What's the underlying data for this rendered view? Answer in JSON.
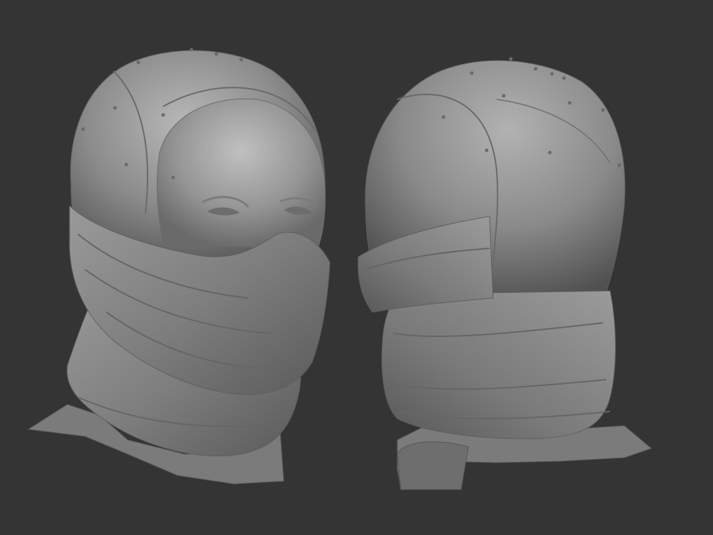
{
  "scene": {
    "background_color": "#343434",
    "clay_color": "#8a8a8a",
    "clay_highlight": "#b4b4b4",
    "clay_shadow": "#4f4f4f",
    "models": [
      {
        "name": "balaclava-front-three-quarter-view"
      },
      {
        "name": "balaclava-back-three-quarter-view"
      }
    ]
  }
}
